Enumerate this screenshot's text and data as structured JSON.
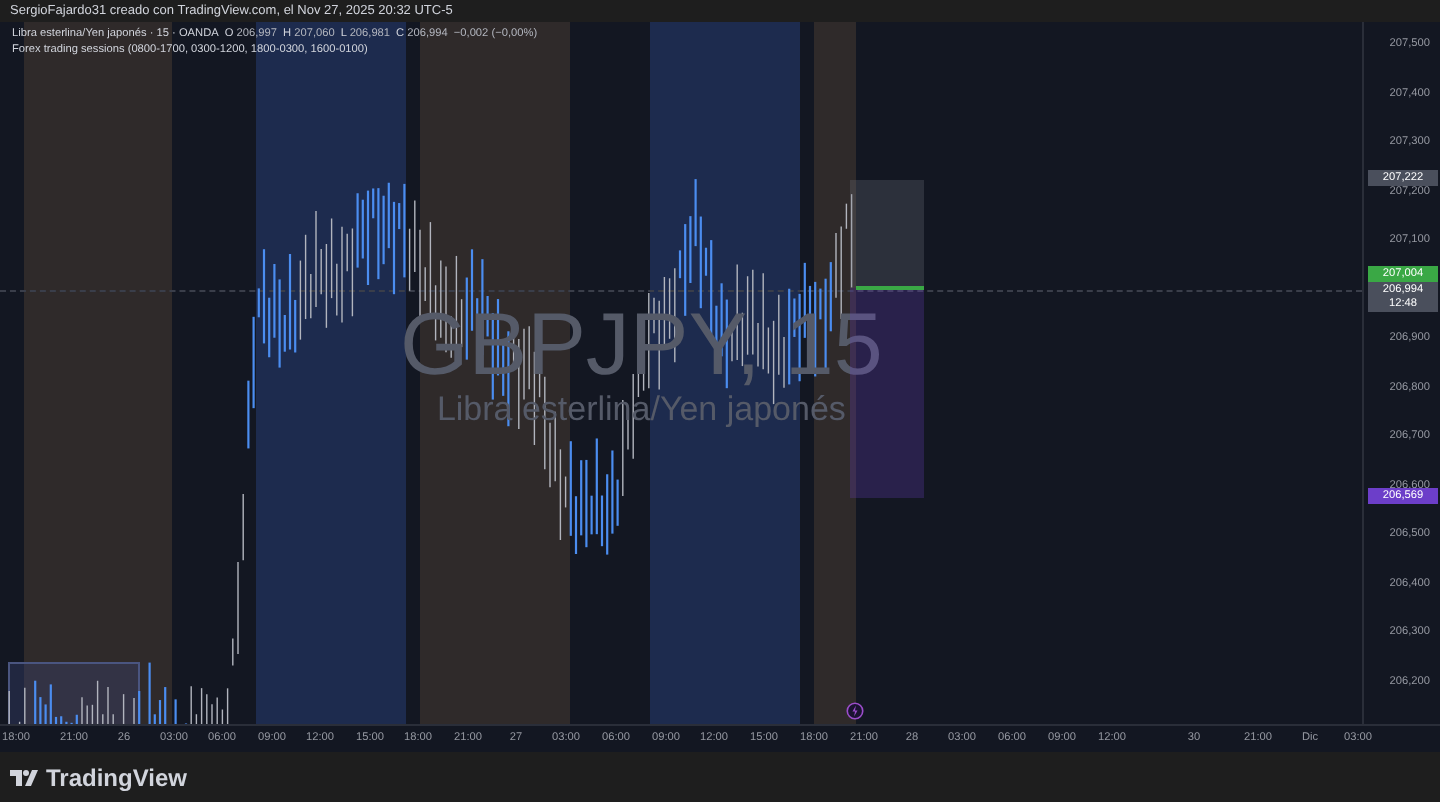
{
  "header": {
    "text": "SergioFajardo31 creado con TradingView.com, el Nov 27, 2025 20:32 UTC-5"
  },
  "legend": {
    "symbol": "Libra esterlina/Yen japonés · 15 · OANDA",
    "ohlc": [
      {
        "label": "O",
        "value": "206,997"
      },
      {
        "label": "H",
        "value": "207,060"
      },
      {
        "label": "L",
        "value": "206,981"
      },
      {
        "label": "C",
        "value": "206,994"
      }
    ],
    "change": "−0,002 (−0,00%)",
    "indicator": "Forex trading sessions (0800-1700, 0300-1200, 1800-0300, 1600-0100)"
  },
  "watermark": {
    "symbol": "GBPJPY, 15",
    "description": "Libra esterlina/Yen japonés"
  },
  "sessions": [
    {
      "color": "#2f2a2a"
    },
    {
      "color": "#1d2b4e"
    },
    {
      "color": "#2f2a2a"
    },
    {
      "color": "#1d2b4e"
    },
    {
      "color": "#2f2a2a"
    }
  ],
  "price_axis": [
    "207,500",
    "207,400",
    "207,300",
    "207,200",
    "207,100",
    "206,900",
    "206,800",
    "206,700",
    "206,600",
    "206,500",
    "206,400",
    "206,300",
    "206,200"
  ],
  "price_badges": [
    {
      "text": "207,222",
      "color": "#4a4f5c"
    },
    {
      "text": "207,004",
      "color": "#3aa845"
    },
    {
      "text": "206,994",
      "color": "#4a4f5c"
    },
    {
      "text": "12:48",
      "color": "#4a4f5c"
    },
    {
      "text": "206,569",
      "color": "#6c3ec9"
    }
  ],
  "time_axis": [
    "18:00",
    "21:00",
    "26",
    "03:00",
    "06:00",
    "09:00",
    "12:00",
    "15:00",
    "18:00",
    "21:00",
    "27",
    "03:00",
    "06:00",
    "09:00",
    "12:00",
    "15:00",
    "18:00",
    "21:00",
    "28",
    "03:00",
    "06:00",
    "09:00",
    "12:00",
    "30",
    "21:00",
    "Dic",
    "03:00"
  ],
  "footer": {
    "brand": "TradingView"
  }
}
